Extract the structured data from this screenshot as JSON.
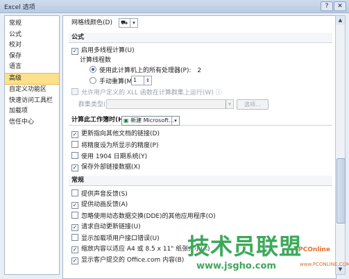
{
  "window": {
    "title": "Excel 选项",
    "help_btn": "?",
    "close_btn": "✕"
  },
  "sidebar": {
    "items": [
      "常规",
      "公式",
      "校对",
      "保存",
      "语言",
      "高级",
      "自定义功能区",
      "快速访问工具栏",
      "加载项",
      "信任中心"
    ],
    "active_index": 5
  },
  "main": {
    "grid_color_label": "网格线颜色(D)",
    "formula_section": "公式",
    "multithread_label": "启用多线程计算(U)",
    "thread_count_label": "计算线程数",
    "use_all_label": "使用此计算机上的所有处理器(P):",
    "use_all_value": "2",
    "manual_label": "手动重算(M)",
    "manual_value": "1",
    "xll_label": "允许用户定义的 XLL 函数在计算群集上运行(W)",
    "cluster_label": "群集类型(C):",
    "options_btn": "选项...",
    "calc_section": "计算此工作簿时(H):",
    "workbook_name": "新建 Microsoft...",
    "calc_items": [
      {
        "label": "更新指向其他文档的链接(D)",
        "checked": true
      },
      {
        "label": "将精度设为所显示的精度(P)",
        "checked": false
      },
      {
        "label": "使用 1904 日期系统(Y)",
        "checked": false
      },
      {
        "label": "保存外部链接数据(X)",
        "checked": true
      }
    ],
    "general_section": "常规",
    "general_items": [
      {
        "label": "提供声音反馈(S)",
        "checked": false
      },
      {
        "label": "提供动画反馈(A)",
        "checked": true
      },
      {
        "label": "忽略使用动态数据交换(DDE)的其他应用程序(O)",
        "checked": false
      },
      {
        "label": "请求自动更新链接(U)",
        "checked": true
      },
      {
        "label": "显示加载项用户接口错误(U)",
        "checked": false
      },
      {
        "label": "缩放内容以适应 A4 或 8.5 x 11\" 纸张大小(A)",
        "checked": true
      },
      {
        "label": "显示客户提交的 Office.com 内容(B)",
        "checked": true
      }
    ]
  },
  "watermark": {
    "cn": "技术员联盟",
    "url": "www.jsgho.com",
    "brand": "PCOnline",
    "brand_url": "www.PCONLINE.COM"
  }
}
